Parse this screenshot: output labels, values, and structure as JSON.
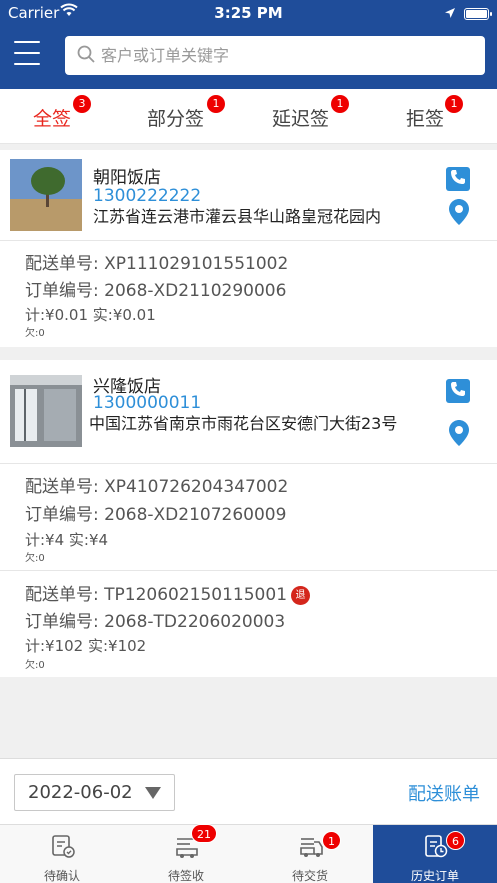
{
  "status_bar": {
    "carrier": "Carrier",
    "time": "3:25 PM"
  },
  "search": {
    "placeholder": "客户或订单关键字"
  },
  "tabs": [
    {
      "label": "全签",
      "badge": "3",
      "active": true
    },
    {
      "label": "部分签",
      "badge": "1",
      "active": false
    },
    {
      "label": "延迟签",
      "badge": "1",
      "active": false
    },
    {
      "label": "拒签",
      "badge": "1",
      "active": false
    }
  ],
  "shops": [
    {
      "name": "朝阳饭店",
      "phone": "1300222222",
      "address": "江苏省连云港市灌云县华山路皇冠花园内",
      "orders": [
        {
          "delivery_no": "配送单号: XP111029101551002",
          "order_no": "订单编号: 2068-XD2110290006",
          "amount": "计:¥0.01   实:¥0.01",
          "owe": "欠:0",
          "return_tag": ""
        }
      ]
    },
    {
      "name": "兴隆饭店",
      "phone": "1300000011",
      "address": "中国江苏省南京市雨花台区安德门大街23号",
      "orders": [
        {
          "delivery_no": "配送单号: XP410726204347002",
          "order_no": "订单编号: 2068-XD2107260009",
          "amount": "计:¥4   实:¥4",
          "owe": "欠:0",
          "return_tag": ""
        },
        {
          "delivery_no": "配送单号: TP120602150115001",
          "order_no": "订单编号: 2068-TD2206020003",
          "amount": "计:¥102   实:¥102",
          "owe": "欠:0",
          "return_tag": "退"
        }
      ]
    }
  ],
  "footer": {
    "date": "2022-06-02",
    "bill_link": "配送账单"
  },
  "bottom_nav": [
    {
      "label": "待确认",
      "badge": "",
      "icon": "confirm-doc-icon"
    },
    {
      "label": "待签收",
      "badge": "21",
      "icon": "sign-box-icon"
    },
    {
      "label": "待交货",
      "badge": "1",
      "icon": "delivery-truck-icon"
    },
    {
      "label": "历史订单",
      "badge": "6",
      "icon": "history-clock-icon",
      "active": true
    }
  ],
  "colors": {
    "primary": "#1f4d9a",
    "accent_red": "#e8281f",
    "link_blue": "#2e8fd8"
  }
}
